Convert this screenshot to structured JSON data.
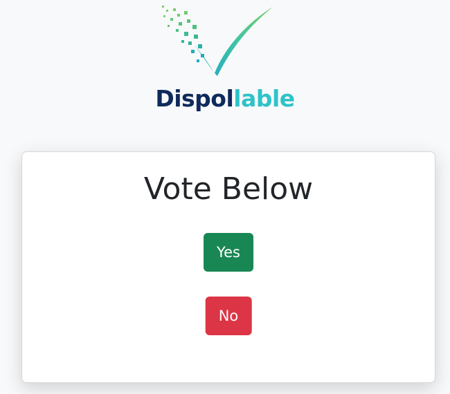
{
  "brand": {
    "name_part1": "Dispol",
    "name_part2": "lable",
    "colors": {
      "navy": "#0f2a5b",
      "teal": "#2ec3c9",
      "green_light": "#7bd06a",
      "teal_dark": "#1fa9c4"
    },
    "logo_icon": "checkmark-pixel-icon"
  },
  "vote": {
    "title": "Vote Below",
    "yes_label": "Yes",
    "no_label": "No",
    "colors": {
      "yes": "#198754",
      "no": "#dc3545"
    }
  }
}
